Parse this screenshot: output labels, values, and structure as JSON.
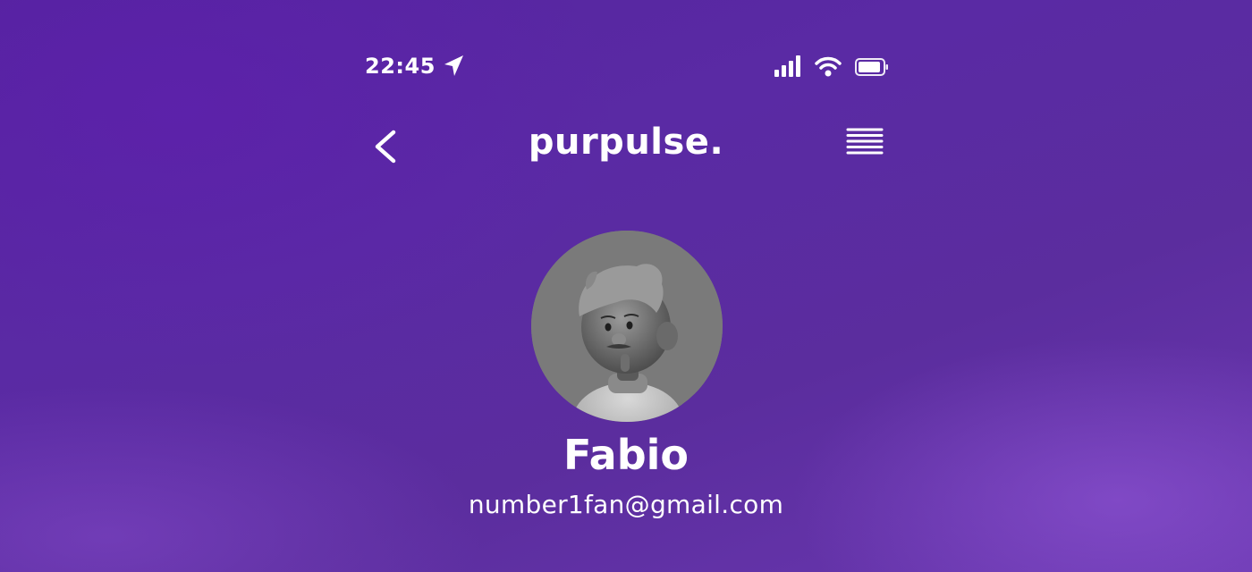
{
  "status_bar": {
    "time": "22:45",
    "icons": [
      "location-arrow-icon",
      "cellular-signal-icon",
      "wifi-icon",
      "battery-icon"
    ]
  },
  "header": {
    "back_icon": "chevron-left-icon",
    "logo": "purpulse.",
    "menu_icon": "hamburger-menu-icon"
  },
  "profile": {
    "avatar": "3d-character-avatar",
    "name": "Fabio",
    "email": "number1fan@gmail.com"
  },
  "colors": {
    "background": "#5a2aa4",
    "text": "#ffffff",
    "avatar_bg": "#7a7a7a"
  }
}
